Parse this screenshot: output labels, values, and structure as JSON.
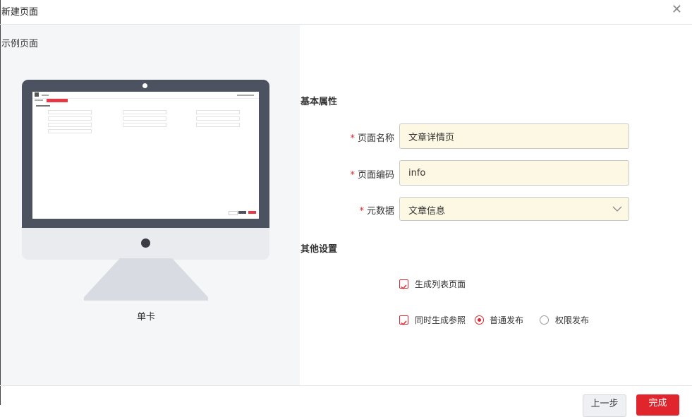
{
  "dialog": {
    "title": "新建页面",
    "close_icon": "close-icon"
  },
  "preview": {
    "title": "示例页面",
    "caption": "单卡"
  },
  "form": {
    "section_basic": "基本属性",
    "page_name": {
      "label": "页面名称",
      "value": "文章详情页"
    },
    "page_code": {
      "label": "页面编码",
      "value": "info"
    },
    "metadata": {
      "label": "元数据",
      "value": "文章信息"
    },
    "section_other": "其他设置",
    "gen_list": {
      "label": "生成列表页面",
      "checked": true
    },
    "gen_ref": {
      "label": "同时生成参照",
      "checked": true
    },
    "publish_normal": {
      "label": "普通发布",
      "selected": true
    },
    "publish_perm": {
      "label": "权限发布",
      "selected": false
    }
  },
  "footer": {
    "prev_label": "上一步",
    "finish_label": "完成"
  },
  "colors": {
    "accent": "#e0262c",
    "input_bg": "#fdf8e3",
    "monitor": "#4d5260"
  }
}
